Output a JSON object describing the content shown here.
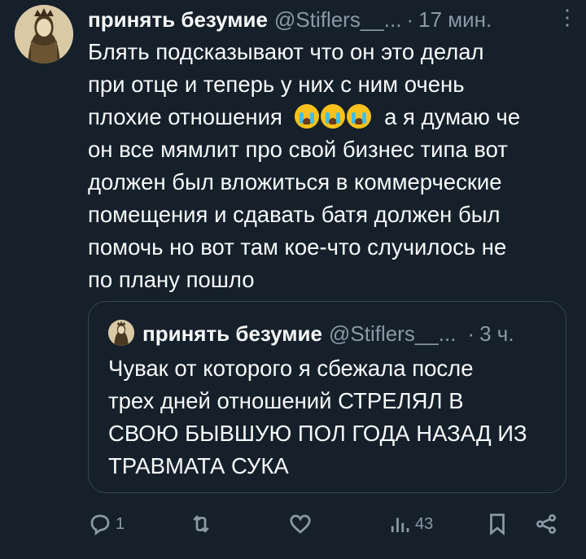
{
  "tweet": {
    "author_name": "принять безумие",
    "author_handle": "@Stiflers__...",
    "separator": "·",
    "time": "17 мин.",
    "more_menu": "⋮",
    "lines": [
      "Блять подсказывают что он это делал",
      "при отце и теперь у них с ним очень",
      "плохие отношения",
      "он все мямлит про свой бизнес типа вот",
      "должен был вложиться в коммерческие",
      "помещения и сдавать батя должен был",
      "помочь но вот там кое-что случилось не",
      "по плану пошло"
    ],
    "line3_suffix": "а я думаю че",
    "emojis": [
      "loudly-crying-face-icon",
      "loudly-crying-face-icon",
      "loudly-crying-face-icon"
    ]
  },
  "quote": {
    "author_name": "принять безумие",
    "author_handle": "@Stiflers__...",
    "separator": "·",
    "time": "3 ч.",
    "lines": [
      "Чувак от которого я сбежала после",
      "трех дней отношений СТРЕЛЯЛ В",
      "СВОЮ БЫВШУЮ ПОЛ ГОДА НАЗАД ИЗ",
      "ТРАВМАТА СУКА"
    ]
  },
  "actions": {
    "reply_count": "1",
    "retweet_count": "",
    "like_count": "",
    "views_count": "43"
  },
  "colors": {
    "background": "#15202b",
    "text": "#f7f9f9",
    "muted": "#8b98a5",
    "border": "#38444d"
  }
}
